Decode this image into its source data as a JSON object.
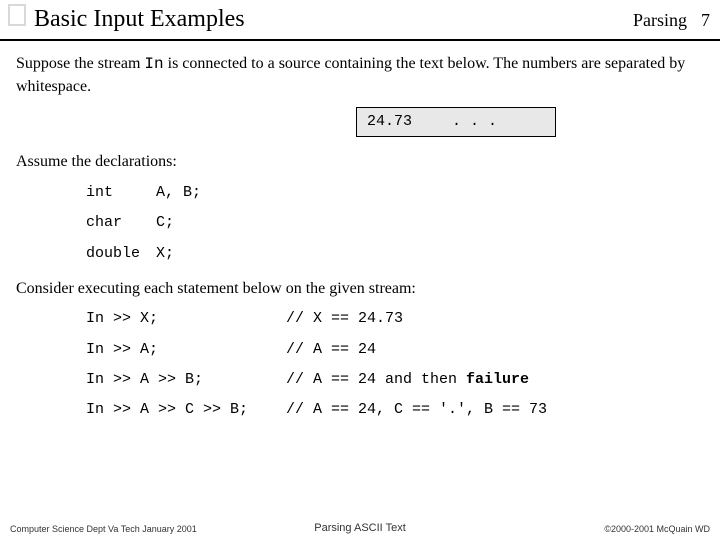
{
  "header": {
    "title": "Basic Input Examples",
    "section": "Parsing",
    "page": "7"
  },
  "intro": {
    "part1": "Suppose the stream ",
    "stream_name": "In",
    "part2": " is connected to a source containing the text below.  The numbers are separated by whitespace."
  },
  "stream": {
    "value": "24.73",
    "ellipsis": ". . ."
  },
  "assume": "Assume the declarations:",
  "decls": [
    {
      "kw": "int",
      "vars": "A, B;"
    },
    {
      "kw": "char",
      "vars": "C;"
    },
    {
      "kw": "double",
      "vars": "X;"
    }
  ],
  "consider": "Consider executing each statement below on the given stream:",
  "stmts": [
    {
      "code": "In >> X;",
      "comment": "// X == 24.73"
    },
    {
      "code": "In >> A;",
      "comment": "// A == 24"
    },
    {
      "code": "In >> A >> B;",
      "comment_pre": "// A == 24 and then ",
      "comment_bold": "failure"
    },
    {
      "code": "In >> A >> C >> B;",
      "comment": "// A == 24, C == '.', B == 73"
    }
  ],
  "footer": {
    "left": "Computer Science Dept Va Tech January 2001",
    "center": "Parsing ASCII Text",
    "right": "©2000-2001  McQuain WD"
  }
}
